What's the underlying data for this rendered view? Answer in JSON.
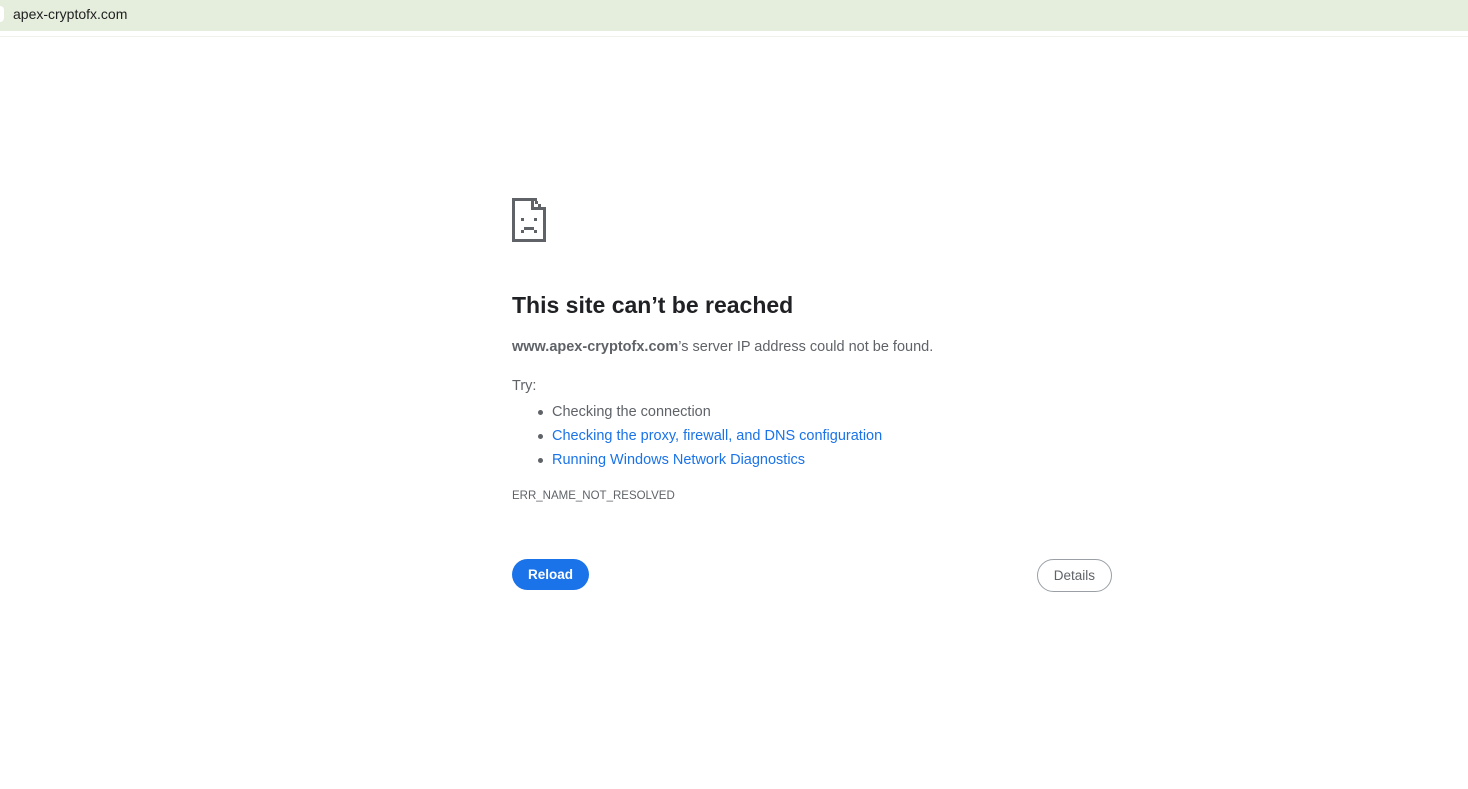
{
  "browser": {
    "url": "apex-cryptofx.com"
  },
  "error_page": {
    "icon": "sad-page-icon",
    "title": "This site can’t be reached",
    "summary_host": "www.apex-cryptofx.com",
    "summary_rest": "’s server IP address could not be found.",
    "try_label": "Try:",
    "suggestions": [
      "Checking the connection",
      "Checking the proxy, firewall, and DNS configuration",
      "Running Windows Network Diagnostics"
    ],
    "error_code": "ERR_NAME_NOT_RESOLVED",
    "reload_label": "Reload",
    "details_label": "Details"
  },
  "colors": {
    "topbar_bg": "#e5eddd",
    "accent_blue": "#1a73e8",
    "text_gray": "#5f6368",
    "title_dark": "#202124"
  }
}
